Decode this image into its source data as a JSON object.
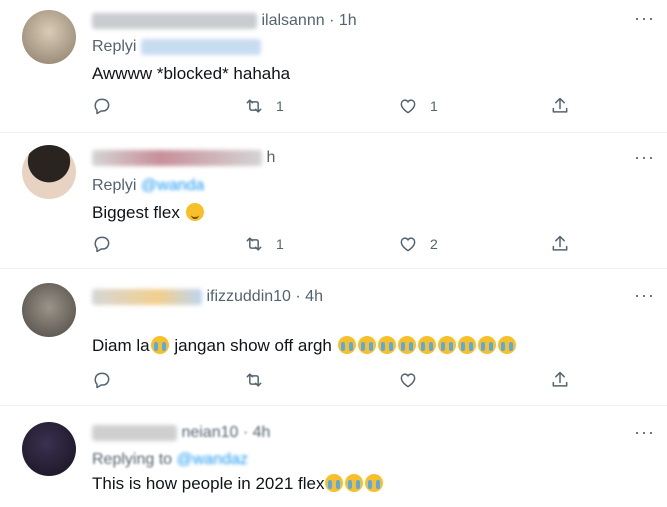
{
  "tweets": [
    {
      "user": "ilalsannn",
      "time": "· 1h",
      "reply_prefix": "Replyi",
      "text": "Awwww *blocked* hahaha",
      "reply_count": "",
      "retweet_count": "1",
      "like_count": "1"
    },
    {
      "user": "h",
      "time": "",
      "reply_prefix": "Replyi",
      "reply_handle": "@wanda",
      "text": "Biggest flex",
      "reply_count": "",
      "retweet_count": "1",
      "like_count": "2"
    },
    {
      "user": "ifizzuddin10",
      "time": "· 4h",
      "text_a": "Diam la",
      "text_b": "jangan show off argh",
      "reply_count": "",
      "retweet_count": "",
      "like_count": ""
    },
    {
      "user": "neian10",
      "time": "· 4h",
      "reply_prefix": "Replying to",
      "reply_handle": "@wandaz",
      "text": "This is how people in 2021 flex"
    }
  ],
  "more_label": "···",
  "icons": [
    "reply-icon",
    "retweet-icon",
    "like-icon",
    "share-icon",
    "more-icon"
  ],
  "colors": {
    "link": "#1d9bf0",
    "muted": "#536471",
    "text": "#0f1419"
  }
}
